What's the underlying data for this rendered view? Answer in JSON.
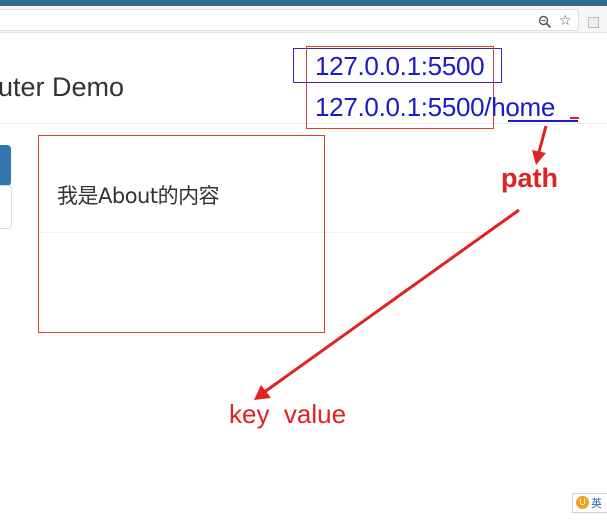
{
  "browser": {
    "toolbar_icons": [
      "zoom-icon",
      "star-icon",
      "extension-icon"
    ],
    "star_glyph": "☆"
  },
  "page": {
    "title": "uter Demo",
    "panel_content": "我是About的内容"
  },
  "annotations": {
    "url_line_1": "127.0.0.1:5500",
    "url_line_2": "127.0.0.1:5500/home",
    "path_label": "path",
    "key_value_label": "key  value",
    "colors": {
      "red": "#e02222",
      "blue": "#1a1ac8",
      "box_blue": "#2f2fb8"
    }
  },
  "taskbar": {
    "ime_icon": "U",
    "ime_label": "英 ."
  }
}
